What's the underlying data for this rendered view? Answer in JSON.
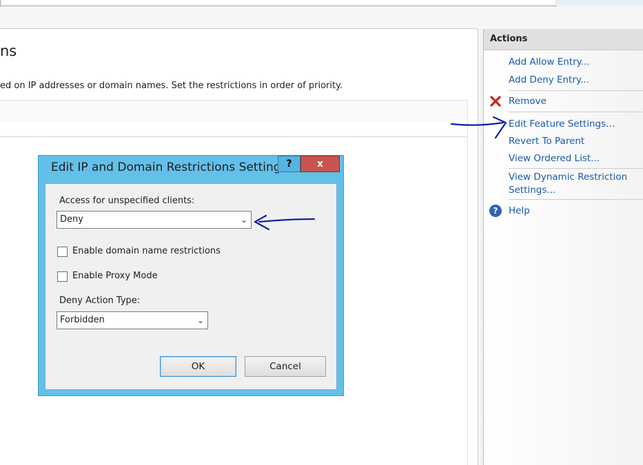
{
  "page": {
    "title_fragment": "ns",
    "description_fragment": "ed on IP addresses or domain names. Set the restrictions in order of priority."
  },
  "actions": {
    "header": "Actions",
    "items": [
      {
        "label": "Add Allow Entry...",
        "icon": "none"
      },
      {
        "label": "Add Deny Entry...",
        "icon": "none"
      },
      {
        "label": "Remove",
        "icon": "red-x-icon"
      },
      {
        "label": "Edit Feature Settings...",
        "icon": "none"
      },
      {
        "label": "Revert To Parent",
        "icon": "none"
      },
      {
        "label": "View Ordered List...",
        "icon": "none"
      },
      {
        "label": "View Dynamic Restriction",
        "label_line2": "Settings...",
        "icon": "none"
      },
      {
        "label": "Help",
        "icon": "help-icon"
      }
    ]
  },
  "dialog": {
    "title": "Edit IP and Domain Restrictions Settings",
    "help_button": "?",
    "close_button": "x",
    "access_label": "Access for unspecified clients:",
    "access_value": "Deny",
    "domain_checkbox_label": "Enable domain name restrictions",
    "domain_checkbox_checked": false,
    "proxy_checkbox_label": "Enable Proxy Mode",
    "proxy_checkbox_checked": false,
    "deny_action_label": "Deny Action Type:",
    "deny_action_value": "Forbidden",
    "ok_label": "OK",
    "cancel_label": "Cancel"
  },
  "colors": {
    "dialog_frame": "#63c0e9",
    "close_button": "#c9544f",
    "link": "#1a5aa8",
    "annotation_ink": "#1420a0"
  }
}
